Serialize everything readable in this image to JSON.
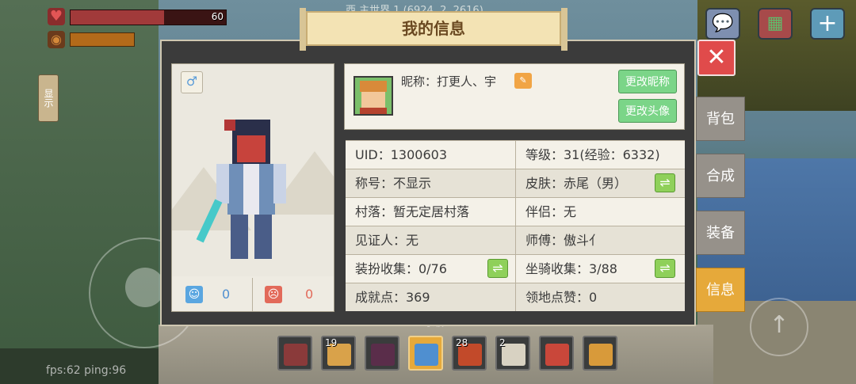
{
  "hud": {
    "health_value": "60",
    "health_fraction": 0.6,
    "hunger_fraction": 0.4,
    "world_name": "西 主世界 1 (6924, 2, 2616)",
    "show_tab": "显示",
    "fps": "fps:62 ping:96",
    "level_text": "等级：31"
  },
  "dialog": {
    "title": "我的信息",
    "close": "✕",
    "nickname": "昵称：打更人、宇",
    "change_nickname": "更改昵称",
    "change_avatar": "更改头像",
    "likes": "0",
    "dislikes": "0"
  },
  "side_tabs": [
    "背包",
    "合成",
    "装备",
    "信息"
  ],
  "info": {
    "left": [
      "UID：1300603",
      "称号：不显示",
      "村落：暂无定居村落",
      "见证人：无",
      "装扮收集：0/76",
      "成就点：369"
    ],
    "right": [
      "等级：31(经验：6332)",
      "皮肤：赤尾（男）",
      "伴侣：无",
      "师傅：傲斗亻",
      "坐骑收集：3/88",
      "领地点赞：0"
    ]
  },
  "hotbar": {
    "counts": [
      "",
      "19",
      "",
      "",
      "28",
      "2",
      "",
      ""
    ],
    "icons": [
      "crossbow-icon",
      "honey-roll-icon",
      "dark-bow-icon",
      "axe-icon",
      "fire-crystal-icon",
      "bone-icon",
      "gift-bag-icon",
      "backpack-icon"
    ],
    "selected_index": 3
  },
  "colors": {
    "accent_orange": "#e6a93a",
    "close_red": "#e04b4b",
    "button_green": "#7bd588",
    "health_red": "#a13a3a"
  }
}
